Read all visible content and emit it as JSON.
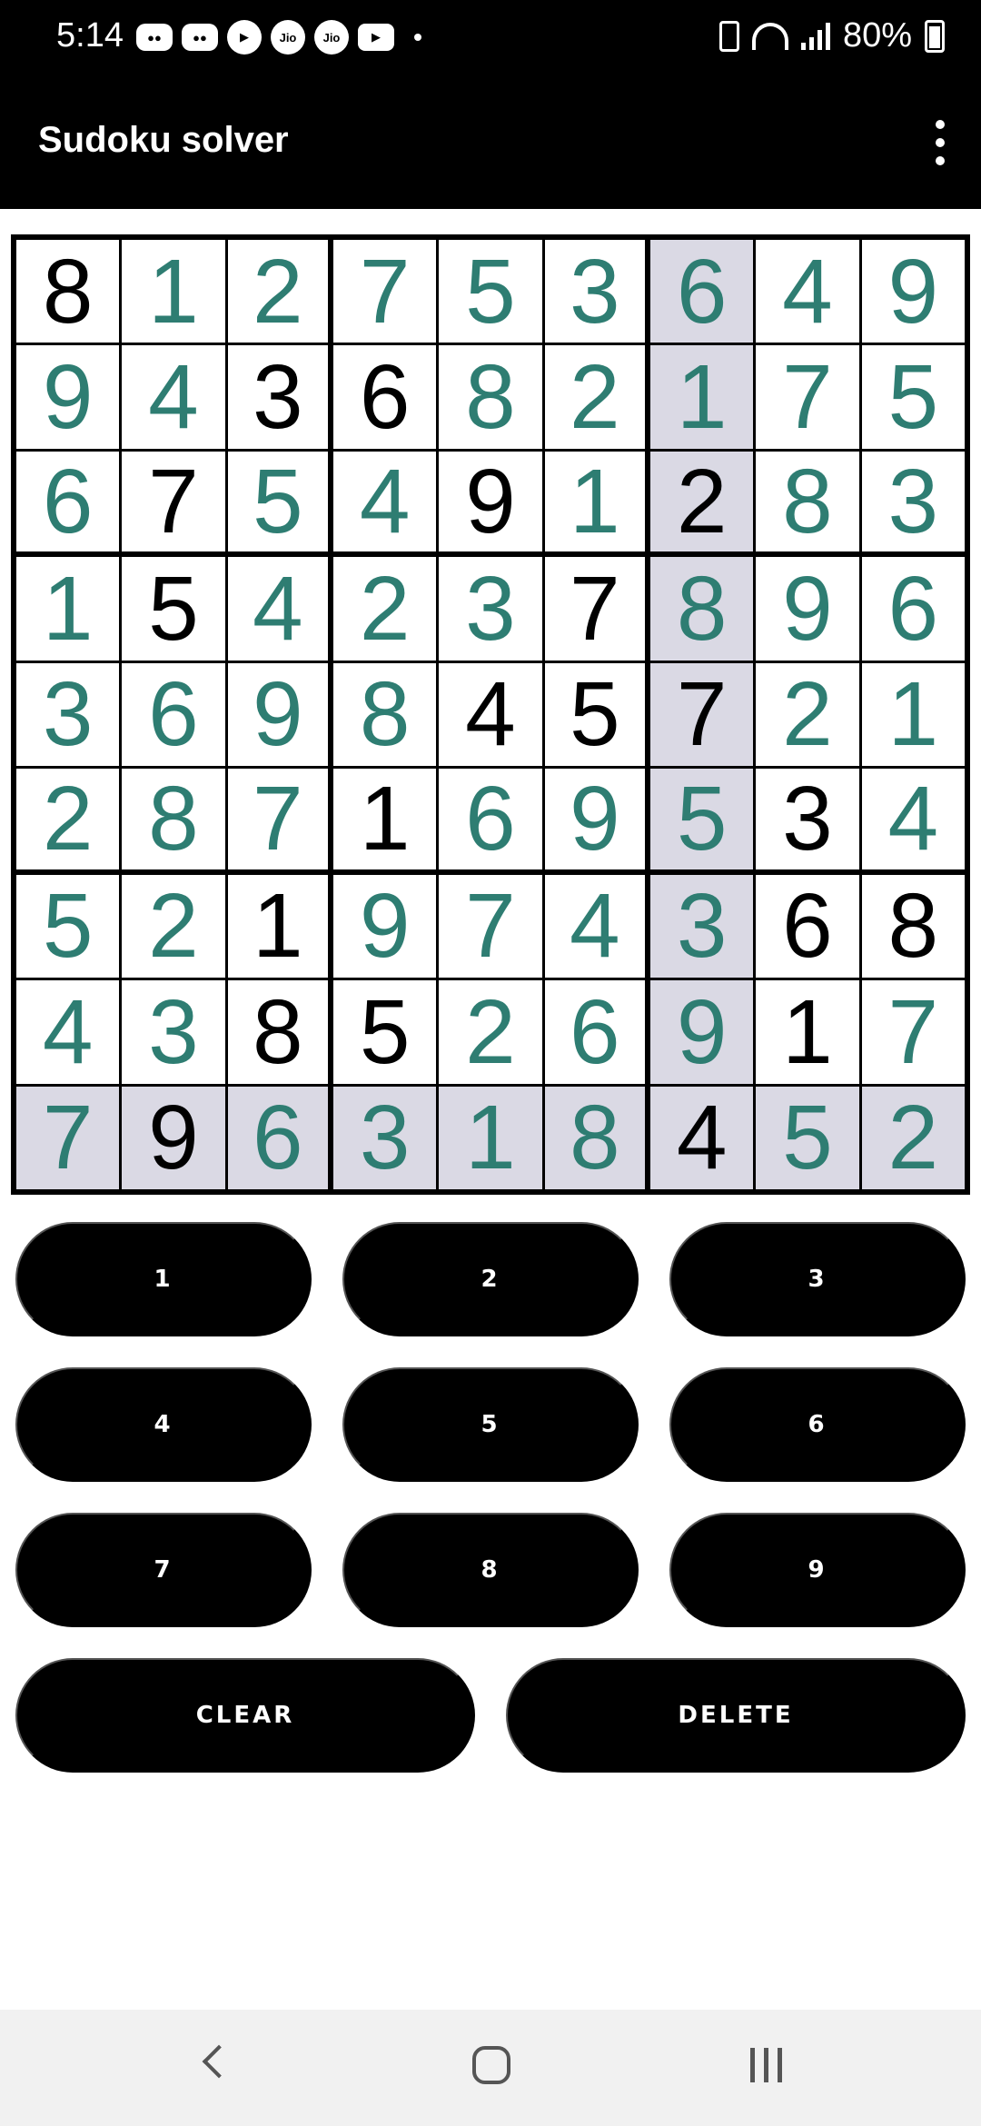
{
  "status_bar": {
    "time": "5:14",
    "battery": "80%",
    "left_icons": [
      "game-controller-icon",
      "game-controller-icon",
      "play-icon",
      "jio-icon",
      "jio-icon",
      "youtube-icon"
    ],
    "jio_label": "Jio"
  },
  "app_bar": {
    "title": "Sudoku solver"
  },
  "colors": {
    "given": "#000000",
    "solved": "#2E7D72",
    "highlight": "#DAD9E4",
    "button": "#000000"
  },
  "board": {
    "values": [
      [
        "8",
        "1",
        "2",
        "7",
        "5",
        "3",
        "6",
        "4",
        "9"
      ],
      [
        "9",
        "4",
        "3",
        "6",
        "8",
        "2",
        "1",
        "7",
        "5"
      ],
      [
        "6",
        "7",
        "5",
        "4",
        "9",
        "1",
        "2",
        "8",
        "3"
      ],
      [
        "1",
        "5",
        "4",
        "2",
        "3",
        "7",
        "8",
        "9",
        "6"
      ],
      [
        "3",
        "6",
        "9",
        "8",
        "4",
        "5",
        "7",
        "2",
        "1"
      ],
      [
        "2",
        "8",
        "7",
        "1",
        "6",
        "9",
        "5",
        "3",
        "4"
      ],
      [
        "5",
        "2",
        "1",
        "9",
        "7",
        "4",
        "3",
        "6",
        "8"
      ],
      [
        "4",
        "3",
        "8",
        "5",
        "2",
        "6",
        "9",
        "1",
        "7"
      ],
      [
        "7",
        "9",
        "6",
        "3",
        "1",
        "8",
        "4",
        "5",
        "2"
      ]
    ],
    "given": [
      [
        1,
        0,
        0,
        0,
        0,
        0,
        0,
        0,
        0
      ],
      [
        0,
        0,
        1,
        1,
        0,
        0,
        0,
        0,
        0
      ],
      [
        0,
        1,
        0,
        0,
        1,
        0,
        1,
        0,
        0
      ],
      [
        0,
        1,
        0,
        0,
        0,
        1,
        0,
        0,
        0
      ],
      [
        0,
        0,
        0,
        0,
        1,
        1,
        1,
        0,
        0
      ],
      [
        0,
        0,
        0,
        1,
        0,
        0,
        0,
        1,
        0
      ],
      [
        0,
        0,
        1,
        0,
        0,
        0,
        0,
        1,
        1
      ],
      [
        0,
        0,
        1,
        1,
        0,
        0,
        0,
        1,
        0
      ],
      [
        0,
        1,
        0,
        0,
        0,
        0,
        1,
        0,
        0
      ]
    ],
    "selected_row": 8,
    "selected_col": 6
  },
  "keypad": {
    "digits": [
      "1",
      "2",
      "3",
      "4",
      "5",
      "6",
      "7",
      "8",
      "9"
    ],
    "clear_label": "CLEAR",
    "delete_label": "DELETE"
  },
  "nav_bar": {
    "icons": [
      "back-icon",
      "home-icon",
      "recents-icon"
    ]
  }
}
